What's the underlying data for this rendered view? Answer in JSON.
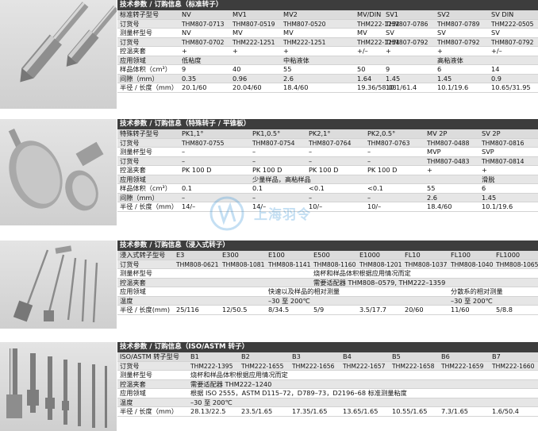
{
  "sections": [
    {
      "title": "技术参数 / 订购信息（标准转子）",
      "columns": [
        {
          "label": "标准转子型号",
          "values": [
            "NV",
            "MV1",
            "MV2",
            "MV/DIN",
            "SV1",
            "SV2",
            "SV DIN"
          ]
        },
        {
          "label": "订货号",
          "values": [
            "THM807-0713",
            "THM807-0519",
            "THM807-0520",
            "THM222-1252",
            "THM807-0786",
            "THM807-0789",
            "THM222-0505"
          ]
        },
        {
          "label": "测量杯型号",
          "values": [
            "NV",
            "MV",
            "MV",
            "MV",
            "SV",
            "SV",
            "SV"
          ]
        },
        {
          "label": "订货号",
          "values": [
            "THM807-0702",
            "THM222-1251",
            "THM222-1251",
            "THM222-1251",
            "THM807-0792",
            "THM807-0792",
            "THM807-0792"
          ]
        },
        {
          "label": "控温夹套",
          "values": [
            "+",
            "+",
            "+",
            "+/–",
            "+",
            "+",
            "+/–"
          ]
        },
        {
          "label": "应用领域",
          "spans": [
            {
              "text": "低粘度",
              "col": 0
            },
            {
              "text": "中粘液体",
              "col": 2
            },
            {
              "text": "高粘液体",
              "col": 5
            }
          ]
        },
        {
          "label": "样品体积（cm³）",
          "values": [
            "9",
            "40",
            "55",
            "50",
            "9",
            "6",
            "14"
          ]
        },
        {
          "label": "间隙（mm）",
          "values": [
            "0.35",
            "0.96",
            "2.6",
            "1.64",
            "1.45",
            "1.45",
            "0.9"
          ]
        },
        {
          "label": "半径 / 长度（mm）",
          "values": [
            "20.1/60",
            "20.04/60",
            "18.4/60",
            "19.36/58.08",
            "10.1/61.4",
            "10.1/19.6",
            "10.65/31.95"
          ]
        }
      ]
    },
    {
      "title": "技术参数 / 订购信息（特殊转子 / 平锥板）",
      "columns": [
        {
          "label": "特殊转子型号",
          "values": [
            "PK1,1°",
            "PK1,0.5°",
            "PK2,1°",
            "PK2,0.5°",
            "MV 2P",
            "SV 2P"
          ]
        },
        {
          "label": "订货号",
          "values": [
            "THM807-0755",
            "THM807-0754",
            "THM807-0764",
            "THM807-0763",
            "THM807-0488",
            "THM807-0816"
          ]
        },
        {
          "label": "测量杯型号",
          "values": [
            "–",
            "–",
            "–",
            "–",
            "MVP",
            "SVP"
          ]
        },
        {
          "label": "订货号",
          "values": [
            "–",
            "–",
            "–",
            "–",
            "THM807-0483",
            "THM807-0814"
          ]
        },
        {
          "label": "控温夹套",
          "values": [
            "PK 100 D",
            "PK 100 D",
            "PK 100 D",
            "PK 100 D",
            "+",
            "+"
          ]
        },
        {
          "label": "应用领域",
          "spans": [
            {
              "text": "少量样品，高粘样品",
              "col": 1
            },
            {
              "text": "滑脱",
              "col": 5
            }
          ]
        },
        {
          "label": "样品体积（cm³）",
          "values": [
            "0.1",
            "0.1",
            "<0.1",
            "<0.1",
            "55",
            "6"
          ]
        },
        {
          "label": "间隙（mm）",
          "values": [
            "–",
            "–",
            "–",
            "–",
            "2.6",
            "1.45"
          ]
        },
        {
          "label": "半径 / 长度（mm）",
          "values": [
            "14/–",
            "14/–",
            "10/–",
            "10/–",
            "18.4/60",
            "10.1/19.6"
          ]
        }
      ]
    },
    {
      "title": "技术参数 / 订购信息（浸入式转子）",
      "columns": [
        {
          "label": "浸入式转子型号",
          "values": [
            "E3",
            "E300",
            "E100",
            "E500",
            "E1000",
            "FL10",
            "FL100",
            "FL1000"
          ]
        },
        {
          "label": "订货号",
          "values": [
            "THM808-0621",
            "THM808-1081",
            "THM808-1141",
            "THM808-1160",
            "THM808-1201",
            "THM808-1037",
            "THM808-1040",
            "THM808-1065"
          ]
        },
        {
          "label": "测量杯型号",
          "spans": [
            {
              "text": "烧杯和样品体积根据应用情况而定",
              "col": 3
            }
          ]
        },
        {
          "label": "控温夹套",
          "spans": [
            {
              "text": "需要适配器 THM808–0579, THM222–1359",
              "col": 3
            }
          ]
        },
        {
          "label": "应用领域",
          "spans": [
            {
              "text": "快速以及样品的相对测量",
              "col": 2
            },
            {
              "text": "分散系的相对测量",
              "col": 6
            }
          ]
        },
        {
          "label": "温度",
          "spans": [
            {
              "text": "–30 至 200℃",
              "col": 2
            },
            {
              "text": "–30 至 200℃",
              "col": 6
            }
          ]
        },
        {
          "label": "半径 / 长度(mm)",
          "values": [
            "25/116",
            "12/50.5",
            "8/34.5",
            "5/9",
            "3.5/17.7",
            "20/60",
            "11/60",
            "5/8.8"
          ]
        }
      ]
    },
    {
      "title": "技术参数 / 订购信息（ISO/ASTM 转子）",
      "columns": [
        {
          "label": "ISO/ASTM 转子型号",
          "values": [
            "B1",
            "B2",
            "B3",
            "B4",
            "B5",
            "B6",
            "B7"
          ]
        },
        {
          "label": "订货号",
          "values": [
            "THM222-1395",
            "THM222-1655",
            "THM222-1656",
            "THM222-1657",
            "THM222-1658",
            "THM222-1659",
            "THM222-1660"
          ]
        },
        {
          "label": "测量杯型号",
          "spans": [
            {
              "text": "烧杯和样品体积根据应用情况而定",
              "col": 0
            }
          ]
        },
        {
          "label": "控温夹套",
          "spans": [
            {
              "text": "需要适配器 THM222–1240",
              "col": 0
            }
          ]
        },
        {
          "label": "应用领域",
          "spans": [
            {
              "text": "根据 ISO 2555，ASTM D115–72，D789–73，D2196–68 标准测量粘度",
              "col": 0
            }
          ]
        },
        {
          "label": "温度",
          "spans": [
            {
              "text": "–30 至 200℃",
              "col": 0
            }
          ]
        },
        {
          "label": "半径 / 长度（mm）",
          "values": [
            "28.13/22.5",
            "23.5/1.65",
            "17.35/1.65",
            "13.65/1.65",
            "10.55/1.65",
            "7.3/1.65",
            "1.6/50.4"
          ]
        }
      ]
    }
  ],
  "watermark": {
    "text": "上海羽令"
  }
}
